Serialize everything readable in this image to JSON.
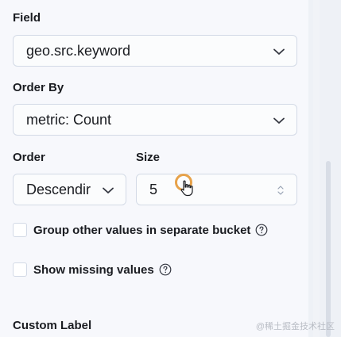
{
  "field": {
    "label": "Field",
    "value": "geo.src.keyword"
  },
  "order_by": {
    "label": "Order By",
    "value": "metric: Count"
  },
  "order": {
    "label": "Order",
    "value": "Descendir"
  },
  "size": {
    "label": "Size",
    "value": "5"
  },
  "checkboxes": {
    "group_other": {
      "label": "Group other values in separate bucket",
      "checked": false
    },
    "show_missing": {
      "label": "Show missing values",
      "checked": false
    }
  },
  "custom_label": {
    "label": "Custom Label"
  },
  "watermark": "@稀土掘金技术社区",
  "icons": {
    "dropdown": "chevron-down-icon",
    "help": "question-circle-icon",
    "stepper": "number-stepper-icon",
    "cursor": "hand-pointer-icon"
  },
  "colors": {
    "panel_bg": "#f7f8fc",
    "border": "#d3dae6",
    "text": "#1a1c21",
    "cursor_ring": "#e7a24a"
  }
}
